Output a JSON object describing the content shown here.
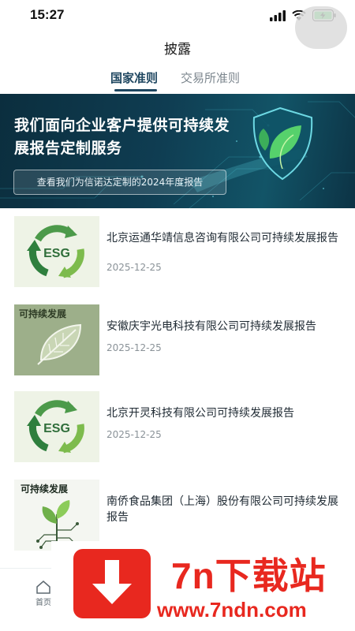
{
  "status_bar": {
    "time": "15:27"
  },
  "header": {
    "title": "披露"
  },
  "tabs": [
    {
      "label": "国家准则",
      "active": true
    },
    {
      "label": "交易所准则",
      "active": false
    }
  ],
  "banner": {
    "title": "我们面向企业客户提供可持续发展报告定制服务",
    "cta_label": "查看我们为信诺达定制的2024年度报告"
  },
  "reports": [
    {
      "title": "北京运通华靖信息咨询有限公司可持续发展报告",
      "date": "2025-12-25",
      "thumb_label": "ESG"
    },
    {
      "title": "安徽庆宇光电科技有限公司可持续发展报告",
      "date": "2025-12-25",
      "thumb_label": "可持续发展"
    },
    {
      "title": "北京开灵科技有限公司可持续发展报告",
      "date": "2025-12-25",
      "thumb_label": "ESG"
    },
    {
      "title": "南侨食品集团（上海）股份有限公司可持续发展报告",
      "date": "",
      "thumb_label": "可持续发展"
    }
  ],
  "bottom_tabbar": {
    "home_label": "首页"
  },
  "watermark": {
    "name": "7n下载站",
    "url": "www.7ndn.com"
  },
  "colors": {
    "accent": "#1e4660",
    "watermark_red": "#e8281f"
  }
}
